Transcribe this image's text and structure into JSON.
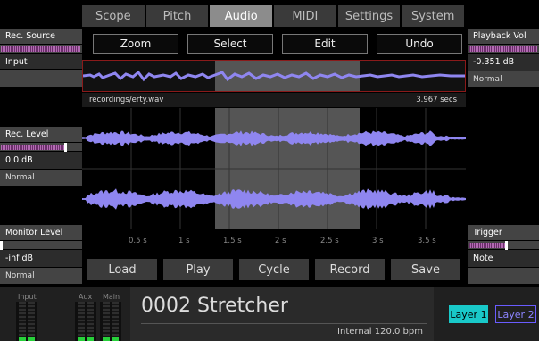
{
  "tabs": [
    {
      "label": "Scope",
      "active": false
    },
    {
      "label": "Pitch",
      "active": false
    },
    {
      "label": "Audio",
      "active": true
    },
    {
      "label": "MIDI",
      "active": false
    },
    {
      "label": "Settings",
      "active": false
    },
    {
      "label": "System",
      "active": false
    }
  ],
  "left_panel": {
    "rec_source": {
      "label": "Rec. Source",
      "value": "Input"
    },
    "rec_level": {
      "label": "Rec. Level",
      "value": "0.0 dB",
      "mode": "Normal",
      "level": 0.82
    },
    "monitor_level": {
      "label": "Monitor Level",
      "value": "-inf dB",
      "mode": "Normal",
      "level": 0.0
    }
  },
  "right_panel": {
    "playback_vol": {
      "label": "Playback Vol",
      "value": "-0.351 dB",
      "mode": "Normal",
      "level": 1.0
    },
    "trigger": {
      "label": "Trigger",
      "value": "Note",
      "level": 0.55
    }
  },
  "top_buttons": {
    "zoom": "Zoom",
    "select": "Select",
    "edit": "Edit",
    "undo": "Undo"
  },
  "file": {
    "name": "recordings/erty.wav",
    "duration": "3.967 secs"
  },
  "ruler_ticks": [
    "0.5 s",
    "1 s",
    "1.5 s",
    "2 s",
    "2.5 s",
    "3 s",
    "3.5 s"
  ],
  "bottom_buttons": {
    "load": "Load",
    "play": "Play",
    "cycle": "Cycle",
    "record": "Record",
    "save": "Save"
  },
  "meters": {
    "input": "Input",
    "aux": "Aux",
    "main": "Main"
  },
  "patch": {
    "name": "0002 Stretcher",
    "tempo": "Internal 120.0 bpm"
  },
  "layers": {
    "layer1": "Layer 1",
    "layer2": "Layer 2"
  },
  "colors": {
    "waveform": "#8f86f0",
    "active_layer": "#19c9c9",
    "layer2_border": "#6a5cff",
    "slider_fill": "#b36ab3"
  }
}
